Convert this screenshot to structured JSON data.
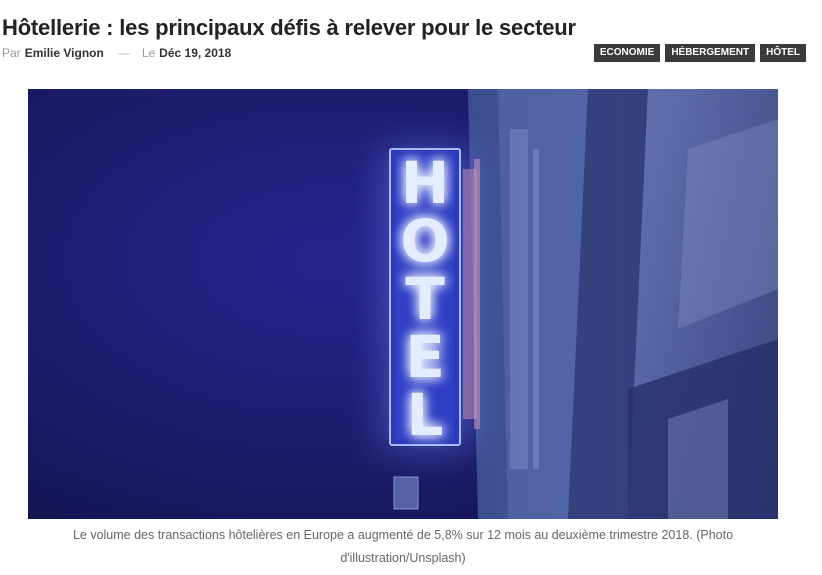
{
  "article": {
    "title": "Hôtellerie : les principaux défis à relever pour le secteur",
    "meta": {
      "by_prefix": "Par",
      "author": "Emilie Vignon",
      "separator": "—",
      "date_prefix": "Le",
      "date": "Déc 19, 2018"
    },
    "tags": [
      "ECONOMIE",
      "HÉBERGEMENT",
      "HÔTEL"
    ],
    "image": {
      "sign_letters": [
        "H",
        "O",
        "T",
        "E",
        "L"
      ],
      "colors": {
        "sky": "#1c1d70",
        "neon": "#d8e4ff",
        "building": "#3c4d8a"
      }
    },
    "caption_line1": "Le volume des transactions hôtelières en Europe a augmenté de 5,8% sur 12 mois au deuxième trimestre 2018. (Photo",
    "caption_line2": "d'illustration/Unsplash)"
  }
}
